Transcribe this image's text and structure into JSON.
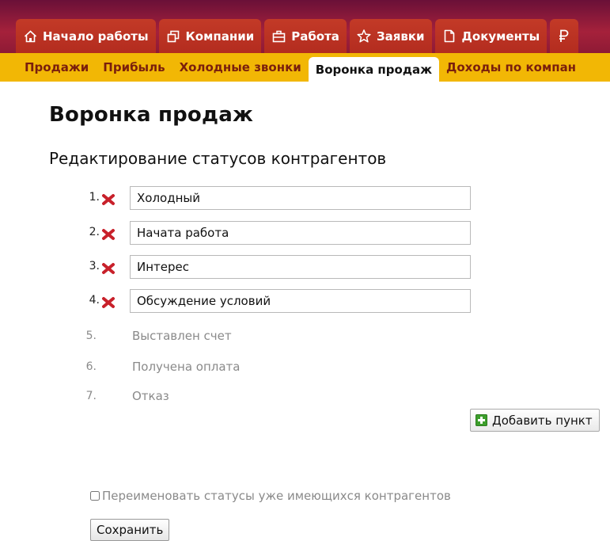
{
  "main_nav": {
    "tabs": [
      {
        "label": "Начало работы",
        "icon": "home-icon"
      },
      {
        "label": "Компании",
        "icon": "windows-icon"
      },
      {
        "label": "Работа",
        "icon": "briefcase-icon"
      },
      {
        "label": "Заявки",
        "icon": "star-icon"
      },
      {
        "label": "Документы",
        "icon": "document-icon"
      },
      {
        "label": "",
        "icon": "ruble-icon"
      }
    ]
  },
  "sub_nav": {
    "tabs": [
      {
        "label": "Продажи",
        "active": false
      },
      {
        "label": "Прибыль",
        "active": false
      },
      {
        "label": "Холодные звонки",
        "active": false
      },
      {
        "label": "Воронка продаж",
        "active": true
      },
      {
        "label": "Доходы по компан",
        "active": false
      }
    ]
  },
  "page": {
    "title": "Воронка продаж",
    "section_title": "Редактирование статусов контрагентов"
  },
  "editable_statuses": [
    {
      "number": "1.",
      "value": "Холодный"
    },
    {
      "number": "2.",
      "value": "Начата работа"
    },
    {
      "number": "3.",
      "value": "Интерес"
    },
    {
      "number": "4.",
      "value": "Обсуждение условий"
    }
  ],
  "fixed_statuses": [
    {
      "number": "5.",
      "label": "Выставлен счет"
    },
    {
      "number": "6.",
      "label": "Получена оплата"
    },
    {
      "number": "7.",
      "label": "Отказ"
    }
  ],
  "actions": {
    "add_label": "Добавить пункт",
    "rename_label": "Переименовать статусы уже имеющихся контрагентов",
    "rename_checked": false,
    "save_label": "Сохранить"
  },
  "colors": {
    "top_bar": "#a5213b",
    "main_tab": "#c33a27",
    "sub_nav": "#f2b705",
    "sub_nav_text": "#7a1f0d",
    "delete_icon": "#c8202a",
    "add_icon": "#3c9e2b"
  }
}
